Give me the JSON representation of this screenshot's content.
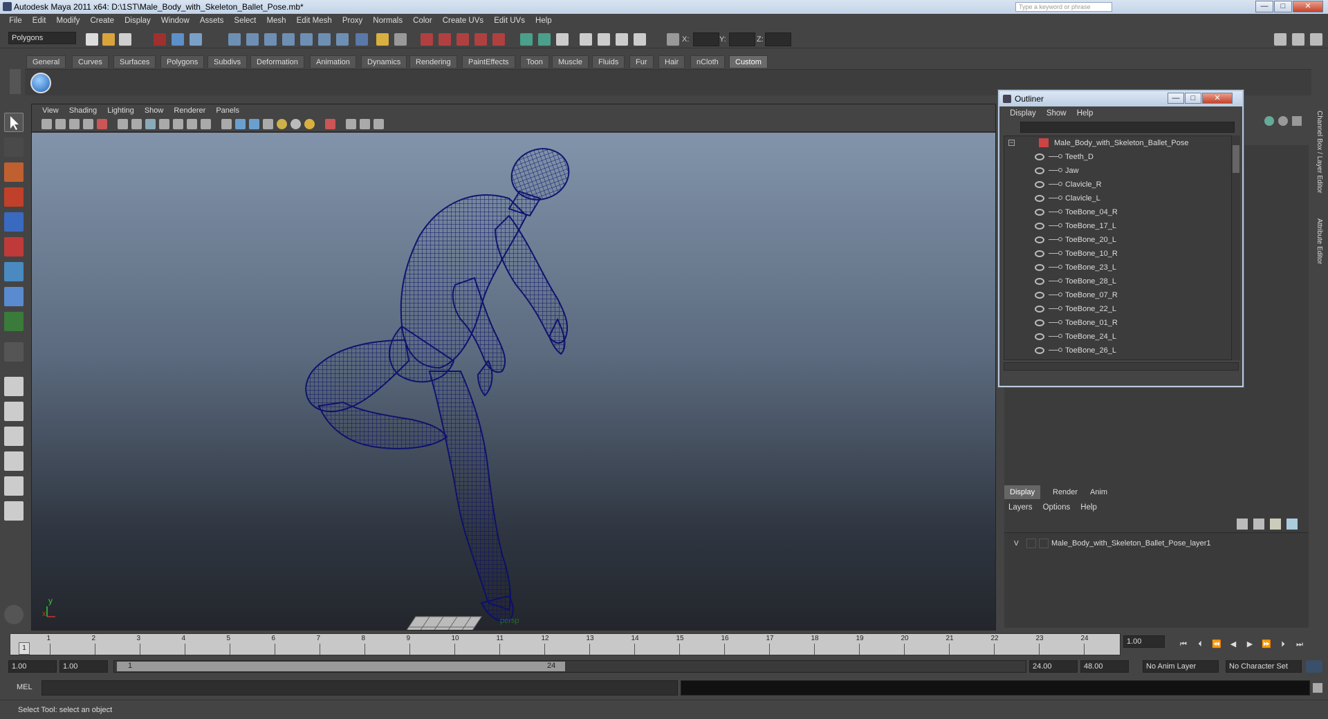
{
  "window": {
    "title": "Autodesk Maya 2011 x64: D:\\1ST\\Male_Body_with_Skeleton_Ballet_Pose.mb*",
    "search_placeholder": "Type a keyword or phrase",
    "minimize": "—",
    "maximize": "□",
    "close": "✕"
  },
  "menubar": [
    "File",
    "Edit",
    "Modify",
    "Create",
    "Display",
    "Window",
    "Assets",
    "Select",
    "Mesh",
    "Edit Mesh",
    "Proxy",
    "Normals",
    "Color",
    "Create UVs",
    "Edit UVs",
    "Help"
  ],
  "statusline": {
    "mode": "Polygons",
    "x_label": "X:",
    "y_label": "Y:",
    "z_label": "Z:"
  },
  "shelf": {
    "tabs": [
      "General",
      "Curves",
      "Surfaces",
      "Polygons",
      "Subdivs",
      "Deformation",
      "Animation",
      "Dynamics",
      "Rendering",
      "PaintEffects",
      "Toon",
      "Muscle",
      "Fluids",
      "Fur",
      "Hair",
      "nCloth",
      "Custom"
    ],
    "active_tab": "Custom"
  },
  "viewport": {
    "menus": [
      "View",
      "Shading",
      "Lighting",
      "Show",
      "Renderer",
      "Panels"
    ],
    "camera_label": "persp",
    "axis_y": "y",
    "axis_x": "x",
    "wire_color": "#0b0f6e"
  },
  "outliner": {
    "title": "Outliner",
    "menus": [
      "Display",
      "Show",
      "Help"
    ],
    "root": "Male_Body_with_Skeleton_Ballet_Pose",
    "items": [
      "Teeth_D",
      "Jaw",
      "Clavicle_R",
      "Clavicle_L",
      "ToeBone_04_R",
      "ToeBone_17_L",
      "ToeBone_20_L",
      "ToeBone_10_R",
      "ToeBone_23_L",
      "ToeBone_28_L",
      "ToeBone_07_R",
      "ToeBone_22_L",
      "ToeBone_01_R",
      "ToeBone_24_L",
      "ToeBone_26_L"
    ]
  },
  "layers": {
    "tabs": [
      "Display",
      "Render",
      "Anim"
    ],
    "active_tab": "Display",
    "menus": [
      "Layers",
      "Options",
      "Help"
    ],
    "visible_flag": "V",
    "layer_name": "Male_Body_with_Skeleton_Ballet_Pose_layer1"
  },
  "sidetabs": [
    "Channel Box / Layer Editor",
    "Attribute Editor"
  ],
  "timeslider": {
    "ticks": [
      "1",
      "2",
      "3",
      "4",
      "5",
      "6",
      "7",
      "8",
      "9",
      "10",
      "11",
      "12",
      "13",
      "14",
      "15",
      "16",
      "17",
      "18",
      "19",
      "20",
      "21",
      "22",
      "23",
      "24"
    ],
    "current_frame": "1",
    "current_field": "1.00"
  },
  "range": {
    "start": "1.00",
    "playback_start": "1.00",
    "range_start_label": "1",
    "range_end_label": "24",
    "playback_end": "24.00",
    "end": "48.00",
    "anim_layer": "No Anim Layer",
    "character_set": "No Character Set"
  },
  "cmdline": {
    "label": "MEL"
  },
  "help": {
    "text": "Select Tool: select an object"
  }
}
